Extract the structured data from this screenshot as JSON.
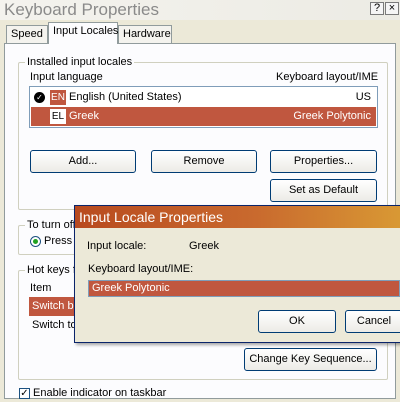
{
  "window": {
    "title": "Keyboard Properties",
    "help_label": "?",
    "close_label": "×"
  },
  "tabs": [
    {
      "label": "Speed"
    },
    {
      "label": "Input Locales"
    },
    {
      "label": "Hardware"
    }
  ],
  "installed_group": {
    "title": "Installed input locales",
    "col_language": "Input language",
    "col_layout": "Keyboard layout/IME",
    "rows": [
      {
        "badge": "EN",
        "language": "English (United States)",
        "layout": "US",
        "checked": true
      },
      {
        "badge": "EL",
        "language": "Greek",
        "layout": "Greek Polytonic",
        "selected": true
      }
    ],
    "add_label": "Add...",
    "remove_label": "Remove",
    "properties_label": "Properties...",
    "default_label": "Set as Default"
  },
  "caps_group": {
    "title_partial": "To turn off",
    "option_partial": "Press"
  },
  "hotkeys_group": {
    "title_partial": "Hot keys f",
    "col_item": "Item",
    "rows": [
      {
        "label": "Switch be",
        "selected": true
      },
      {
        "label": "Switch to",
        "selected": false
      }
    ],
    "change_label": "Change Key Sequence..."
  },
  "indicator": {
    "label": "Enable indicator on taskbar",
    "checked": true
  },
  "dialog": {
    "title": "Input Locale Properties",
    "locale_label": "Input locale:",
    "locale_value": "Greek",
    "layout_label": "Keyboard layout/IME:",
    "layout_value": "Greek Polytonic",
    "ok_label": "OK",
    "cancel_label": "Cancel"
  },
  "colors": {
    "selection": "#c0573f",
    "dialog_title_start": "#b84a1f",
    "dialog_title_end": "#d99a34"
  }
}
